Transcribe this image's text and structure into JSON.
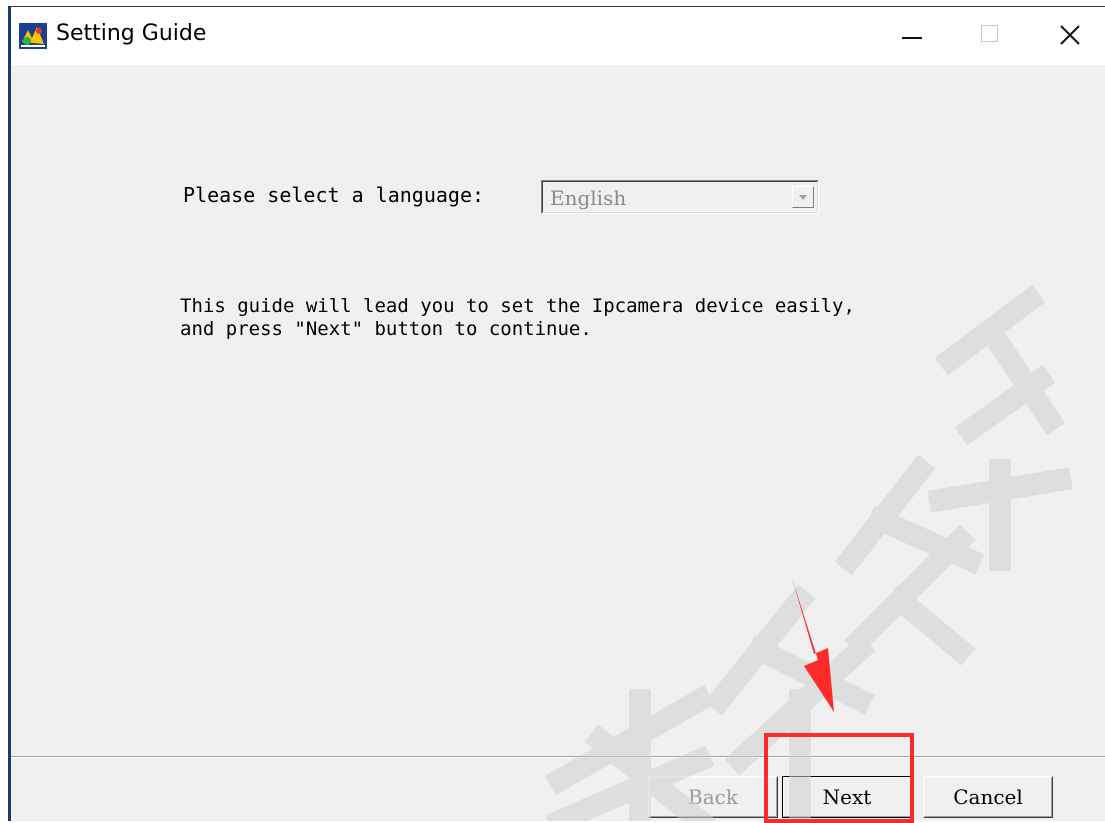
{
  "window": {
    "title": "Setting Guide"
  },
  "titlebar": {
    "minimize_icon": "minimize-icon",
    "maximize_icon": "maximize-icon",
    "close_icon": "close-icon"
  },
  "content": {
    "language_label": "Please select a language:",
    "language_selected": "English",
    "guide_text": "This guide will lead you to set the Ipcamera device easily,\nand press \"Next\" button to continue."
  },
  "buttons": {
    "back": "Back",
    "next": "Next",
    "cancel": "Cancel"
  },
  "annotation": {
    "highlight_color": "#ff2a2a"
  },
  "watermark": {
    "text": "寿屏视频"
  }
}
